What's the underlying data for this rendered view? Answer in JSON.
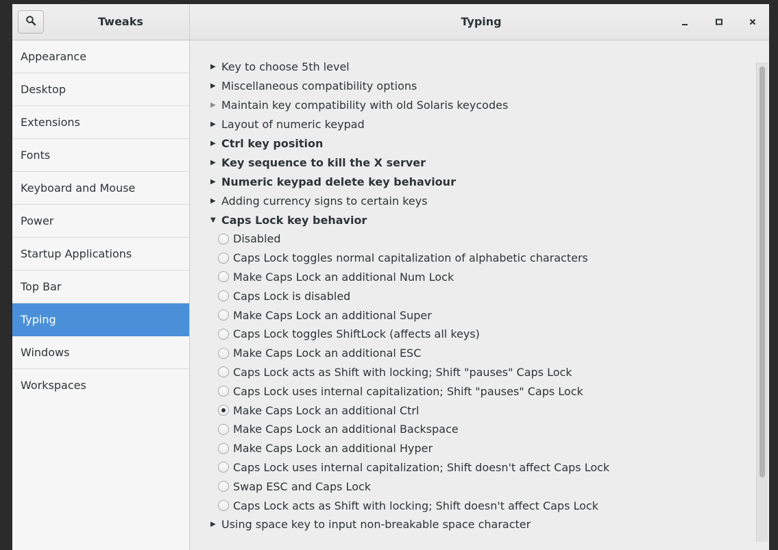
{
  "window": {
    "left_title": "Tweaks",
    "main_title": "Typing",
    "minimize_icon": "minimize-icon",
    "maximize_icon": "maximize-icon",
    "close_icon": "close-icon",
    "search_icon": "search-icon"
  },
  "sidebar": {
    "selected": "Typing",
    "selected_color": "#4a90d9",
    "items": [
      {
        "label": "Appearance"
      },
      {
        "label": "Desktop"
      },
      {
        "label": "Extensions"
      },
      {
        "label": "Fonts"
      },
      {
        "label": "Keyboard and Mouse"
      },
      {
        "label": "Power"
      },
      {
        "label": "Startup Applications"
      },
      {
        "label": "Top Bar"
      },
      {
        "label": "Typing"
      },
      {
        "label": "Windows"
      },
      {
        "label": "Workspaces"
      }
    ]
  },
  "content": {
    "groups_before": [
      {
        "label": "Key to choose 5th level",
        "bold": false
      },
      {
        "label": "Miscellaneous compatibility options",
        "bold": false
      },
      {
        "label": "Maintain key compatibility with old Solaris keycodes",
        "bold": false,
        "dim_arrow": true
      },
      {
        "label": "Layout of numeric keypad",
        "bold": false
      },
      {
        "label": "Ctrl key position",
        "bold": true
      },
      {
        "label": "Key sequence to kill the X server",
        "bold": true
      },
      {
        "label": "Numeric keypad delete key behaviour",
        "bold": true
      },
      {
        "label": "Adding currency signs to certain keys",
        "bold": false
      }
    ],
    "expanded_group": {
      "label": "Caps Lock key behavior",
      "selected_option": "Make Caps Lock an additional Ctrl",
      "options": [
        "Disabled",
        "Caps Lock toggles normal capitalization of alphabetic characters",
        "Make Caps Lock an additional Num Lock",
        "Caps Lock is disabled",
        "Make Caps Lock an additional Super",
        "Caps Lock toggles ShiftLock (affects all keys)",
        "Make Caps Lock an additional ESC",
        "Caps Lock acts as Shift with locking; Shift \"pauses\" Caps Lock",
        "Caps Lock uses internal capitalization; Shift \"pauses\" Caps Lock",
        "Make Caps Lock an additional Ctrl",
        "Make Caps Lock an additional Backspace",
        "Make Caps Lock an additional Hyper",
        "Caps Lock uses internal capitalization; Shift doesn't affect Caps Lock",
        "Swap ESC and Caps Lock",
        "Caps Lock acts as Shift with locking; Shift doesn't affect Caps Lock"
      ]
    },
    "groups_after": [
      {
        "label": "Using space key to input non-breakable space character",
        "bold": false
      }
    ]
  }
}
